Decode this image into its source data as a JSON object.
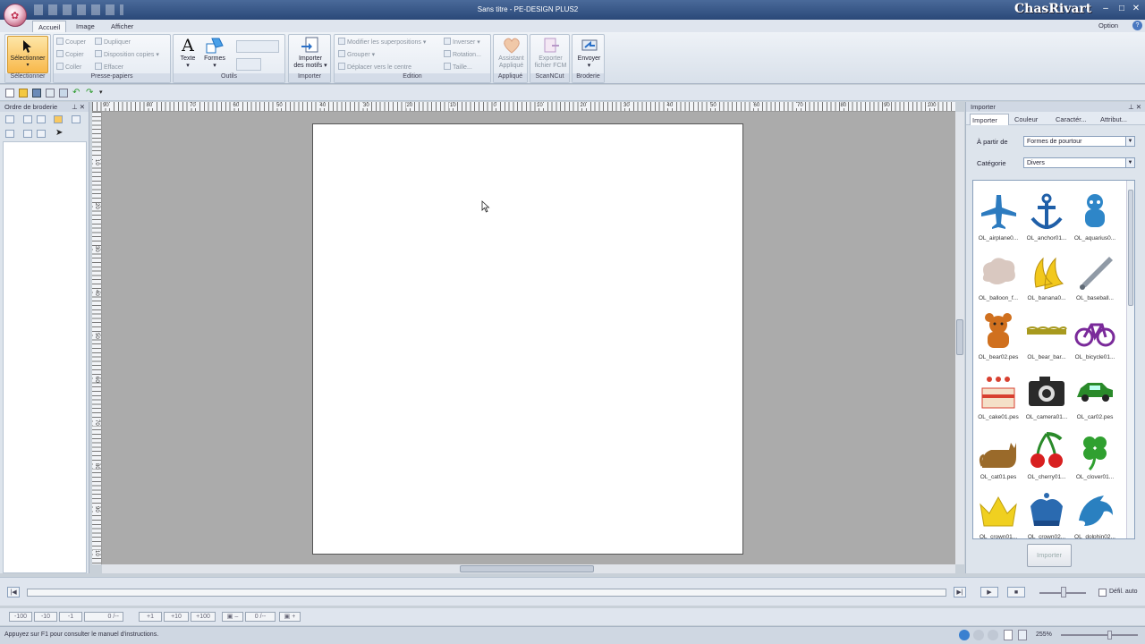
{
  "titlebar": {
    "title": "Sans titre - PE-DESIGN PLUS2",
    "brand": "ChasRivart"
  },
  "tabs": [
    {
      "label": "Accueil"
    },
    {
      "label": "Image"
    },
    {
      "label": "Afficher"
    }
  ],
  "option": "Option",
  "ribbon": {
    "selectionner": {
      "button": "Sélectionner",
      "group": "Sélectionner"
    },
    "presse_papiers": {
      "couper": "Couper",
      "copier": "Copier",
      "coller": "Coller",
      "dupliquer": "Dupliquer",
      "disposition": "Disposition copies",
      "effacer": "Effacer",
      "group": "Presse-papiers"
    },
    "outils": {
      "texte": "Texte",
      "formes": "Formes",
      "group": "Outils"
    },
    "importer": {
      "button_line1": "Importer",
      "button_line2": "des motifs",
      "group": "Importer"
    },
    "edition": {
      "modifier": "Modifier les superpositions",
      "grouper": "Grouper",
      "deplacer": "Déplacer vers le centre",
      "inverser": "Inverser",
      "rotation": "Rotation...",
      "taille": "Taille...",
      "group": "Edition"
    },
    "applique": {
      "line1": "Assistant",
      "line2": "Appliqué",
      "group": "Appliqué"
    },
    "scanncut": {
      "line1": "Exporter",
      "line2": "fichier FCM",
      "group": "ScanNCut"
    },
    "broderie": {
      "line1": "Envoyer",
      "group": "Broderie"
    }
  },
  "left_panel": {
    "title": "Ordre de broderie"
  },
  "ruler": {
    "h": [
      "90",
      "80",
      "70",
      "60",
      "50",
      "40",
      "30",
      "20",
      "10",
      "0",
      "10",
      "20",
      "30",
      "40",
      "50",
      "60",
      "70",
      "80",
      "90",
      "100",
      "110"
    ],
    "v": [
      "10",
      "20",
      "30",
      "40",
      "50",
      "60",
      "70",
      "80",
      "90",
      "10"
    ]
  },
  "right_panel": {
    "title": "Importer",
    "tabs": [
      {
        "label": "Importer"
      },
      {
        "label": "Couleur"
      },
      {
        "label": "Caractér..."
      },
      {
        "label": "Attribut..."
      }
    ],
    "source_label": "À partir de",
    "source_value": "Formes de pourtour",
    "category_label": "Catégorie",
    "category_value": "Divers",
    "items": [
      {
        "caption": "OL_airplane0...",
        "icon": "airplane-icon",
        "color": "#2d7bbf"
      },
      {
        "caption": "OL_anchor01...",
        "icon": "anchor-icon",
        "color": "#1f5fa8"
      },
      {
        "caption": "OL_aquarius0...",
        "icon": "aquarius-icon",
        "color": "#2e86c8"
      },
      {
        "caption": "OL_balloon_f...",
        "icon": "balloon-icon",
        "color": "#d9c8c0"
      },
      {
        "caption": "OL_banana0...",
        "icon": "banana-icon",
        "color": "#f2c81c"
      },
      {
        "caption": "OL_baseball...",
        "icon": "baseball-bat-icon",
        "color": "#909aa6"
      },
      {
        "caption": "OL_bear02.pes",
        "icon": "bear-icon",
        "color": "#d0701e"
      },
      {
        "caption": "OL_bear_bar...",
        "icon": "bear-bar-icon",
        "color": "#a89a1e"
      },
      {
        "caption": "OL_bicycle01...",
        "icon": "bicycle-icon",
        "color": "#7a2a9a"
      },
      {
        "caption": "OL_cake01.pes",
        "icon": "cake-icon",
        "color": "#d84030"
      },
      {
        "caption": "OL_camera01...",
        "icon": "camera-icon",
        "color": "#2a2a2a"
      },
      {
        "caption": "OL_car02.pes",
        "icon": "car-icon",
        "color": "#2a8a2a"
      },
      {
        "caption": "OL_cat01.pes",
        "icon": "cat-icon",
        "color": "#9a6a2a"
      },
      {
        "caption": "OL_cherry01...",
        "icon": "cherry-icon",
        "color": "#d82020"
      },
      {
        "caption": "OL_clover01...",
        "icon": "clover-icon",
        "color": "#30a030"
      },
      {
        "caption": "OL_crown01...",
        "icon": "crown-icon",
        "color": "#f0d020"
      },
      {
        "caption": "OL_crown02...",
        "icon": "crown2-icon",
        "color": "#2a6ab0"
      },
      {
        "caption": "OL_dolphin02...",
        "icon": "dolphin-icon",
        "color": "#2a80c0"
      }
    ],
    "import_button": "Importer"
  },
  "playback": {
    "autoscroll_label": "Défil. auto"
  },
  "stepbar": {
    "buttons": [
      "-100",
      "-10",
      "-1",
      "+1",
      "+10",
      "+100"
    ],
    "field": "0 /--"
  },
  "status": {
    "hint": "Appuyez sur F1 pour consulter le manuel d'instructions.",
    "zoom": "255%"
  },
  "colors": {
    "ribbon_selected": "#f8b84a",
    "canvas_bg": "#ababab"
  }
}
